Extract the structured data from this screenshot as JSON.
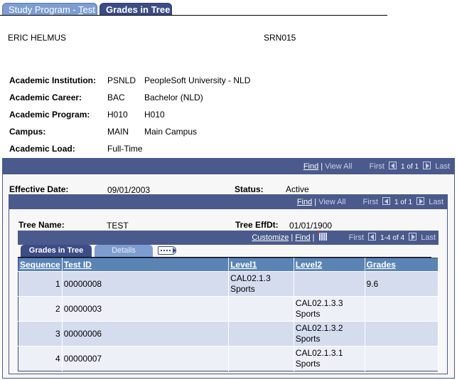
{
  "page_tabs": [
    {
      "label": "Study Program - Test",
      "active": false
    },
    {
      "label": "Grades in Tree",
      "active": true
    }
  ],
  "student": {
    "name": "ERIC HELMUS",
    "id": "SRN015"
  },
  "academic": [
    {
      "label": "Academic Institution:",
      "code": "PSNLD",
      "desc": "PeopleSoft University -  NLD"
    },
    {
      "label": "Academic Career:",
      "code": "BAC",
      "desc": "Bachelor (NLD)"
    },
    {
      "label": "Academic Program:",
      "code": "H010",
      "desc": "H010"
    },
    {
      "label": "Campus:",
      "code": "MAIN",
      "desc": "Main Campus"
    },
    {
      "label": "Academic Load:",
      "code": "Full-Time",
      "desc": ""
    }
  ],
  "outer_nav": {
    "find": "Find",
    "view_all": "View All",
    "first": "First",
    "count": "1 of 1",
    "last": "Last"
  },
  "effective": {
    "date_label": "Effective Date:",
    "date_value": "09/01/2003",
    "status_label": "Status:",
    "status_value": "Active"
  },
  "inner_nav": {
    "find": "Find",
    "view_all": "View All",
    "first": "First",
    "count": "1 of 1",
    "last": "Last"
  },
  "tree": {
    "name_label": "Tree Name:",
    "name_value": "TEST",
    "effdt_label": "Tree EffDt:",
    "effdt_value": "01/01/1900"
  },
  "grid_nav": {
    "customize": "Customize",
    "find": "Find",
    "first": "First",
    "count": "1-4 of 4",
    "last": "Last"
  },
  "grid_tabs": [
    {
      "label": "Grades in Tree",
      "active": true
    },
    {
      "label": "Details",
      "active": false
    }
  ],
  "grid": {
    "columns": [
      "Sequence",
      "Test ID",
      "Level1",
      "Level2",
      "Grades"
    ],
    "rows": [
      {
        "sequence": "1",
        "test_id": "00000008",
        "level1": "CAL02.1.3 Sports",
        "level2": "",
        "grades": "9.6"
      },
      {
        "sequence": "2",
        "test_id": "00000003",
        "level1": "",
        "level2": "CAL02.1.3.3 Sports",
        "grades": ""
      },
      {
        "sequence": "3",
        "test_id": "00000006",
        "level1": "",
        "level2": "CAL02.1.3.2 Sports",
        "grades": ""
      },
      {
        "sequence": "4",
        "test_id": "00000007",
        "level1": "",
        "level2": "CAL02.1.3.1 Sports",
        "grades": ""
      }
    ]
  }
}
